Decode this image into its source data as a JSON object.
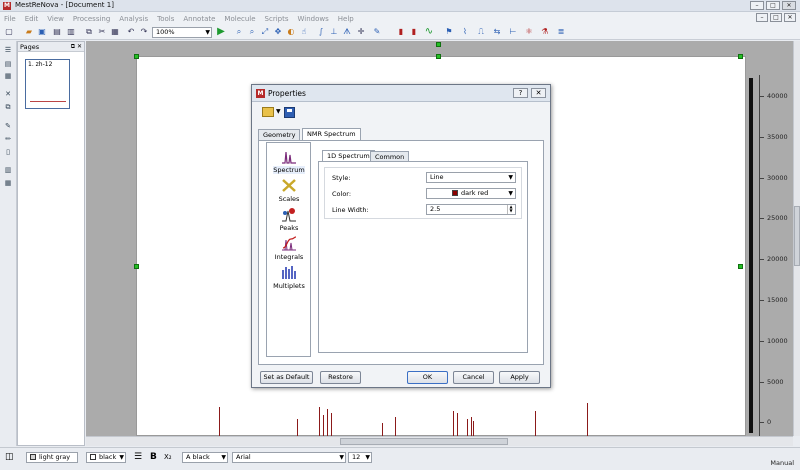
{
  "window": {
    "title": "MestReNova - [Document 1]",
    "app_icon": "M",
    "minimize": "–",
    "maximize": "□",
    "close": "✕"
  },
  "menu": [
    "File",
    "Edit",
    "View",
    "Processing",
    "Analysis",
    "Tools",
    "Annotate",
    "Molecule",
    "Scripts",
    "Windows",
    "Help"
  ],
  "toolbar": {
    "zoom": "100%"
  },
  "pages_panel": {
    "title": "Pages",
    "controls": "⧉ ✕",
    "thumbnail_label": "1. zh-12"
  },
  "axis": {
    "ticks": [
      "40000",
      "35000",
      "30000",
      "25000",
      "20000",
      "15000",
      "10000",
      "5000",
      "0"
    ]
  },
  "bottom_toolbar": {
    "bg_color": "light gray",
    "line_color": "black",
    "font_color": "black",
    "font_name": "Arial",
    "font_size": "12",
    "bold": "B",
    "subscript": "X₂",
    "font_prefix": "A",
    "status": "Manual"
  },
  "dialog": {
    "title": "Properties",
    "help_btn": "?",
    "close_btn": "✕",
    "tabs": [
      "Geometry",
      "NMR Spectrum"
    ],
    "active_tab": "NMR Spectrum",
    "categories": [
      "Spectrum",
      "Scales",
      "Peaks",
      "Integrals",
      "Multiplets"
    ],
    "selected_category": "Spectrum",
    "subtabs": [
      "1D Spectrum",
      "Common"
    ],
    "fields": {
      "style_label": "Style:",
      "style_value": "Line",
      "color_label": "Color:",
      "color_value": "dark red",
      "linewidth_label": "Line Width:",
      "linewidth_value": "2.5"
    },
    "buttons": {
      "set_default": "Set as Default",
      "restore": "Restore",
      "ok": "OK",
      "cancel": "Cancel",
      "apply": "Apply"
    }
  },
  "colors": {
    "spectrum": "#8b1a1a",
    "handle": "#25c025",
    "accent": "#3b6fc4"
  }
}
